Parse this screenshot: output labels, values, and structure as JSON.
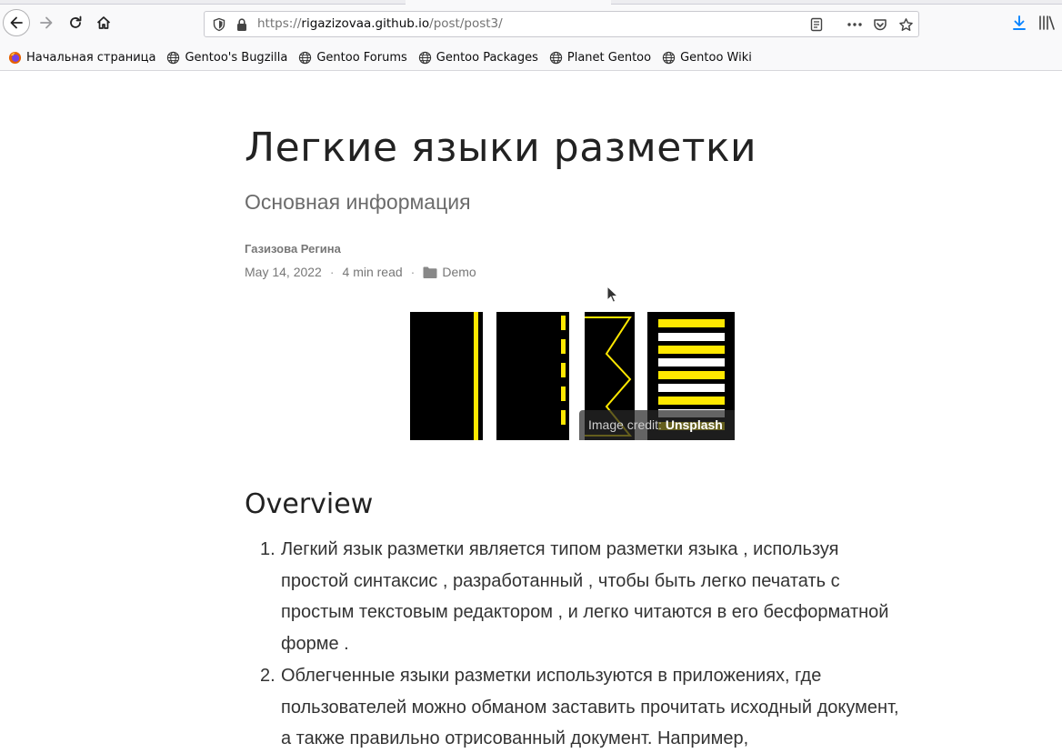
{
  "browser": {
    "url_prefix": "https://",
    "url_host": "rigazizovaa.github.io",
    "url_path": "/post/post3/"
  },
  "bookmarks": [
    {
      "label": "Начальная страница",
      "icon": "firefox-icon"
    },
    {
      "label": "Gentoo's Bugzilla",
      "icon": "globe-icon"
    },
    {
      "label": "Gentoo Forums",
      "icon": "globe-icon"
    },
    {
      "label": "Gentoo Packages",
      "icon": "globe-icon"
    },
    {
      "label": "Planet Gentoo",
      "icon": "globe-icon"
    },
    {
      "label": "Gentoo Wiki",
      "icon": "globe-icon"
    }
  ],
  "post": {
    "title": "Легкие языки разметки",
    "subtitle": "Основная информация",
    "author": "Газизова Регина",
    "date": "May 14, 2022",
    "separator": "·",
    "read_time": "4 min read",
    "category": "Demo",
    "image_credit_prefix": "Image credit: ",
    "image_credit_link": "Unsplash"
  },
  "content": {
    "heading": "Overview",
    "items": [
      {
        "num": "1.",
        "text": "Легкий язык разметки является типом разметки языка , используя простой синтаксис , разработанный , чтобы быть легко печатать с простым текстовым редактором , и легко читаются в его бесформатной форме ."
      },
      {
        "num": "2.",
        "text": "Облегченные языки разметки используются в приложениях, где пользователей можно обманом заставить прочитать исходный документ, а также правильно отрисованный документ. Например,"
      }
    ]
  },
  "colors": {
    "accent_download": "#0a84ff",
    "road_yellow": "#ffe800",
    "text_dark": "#222222",
    "text_meta": "#777777"
  }
}
